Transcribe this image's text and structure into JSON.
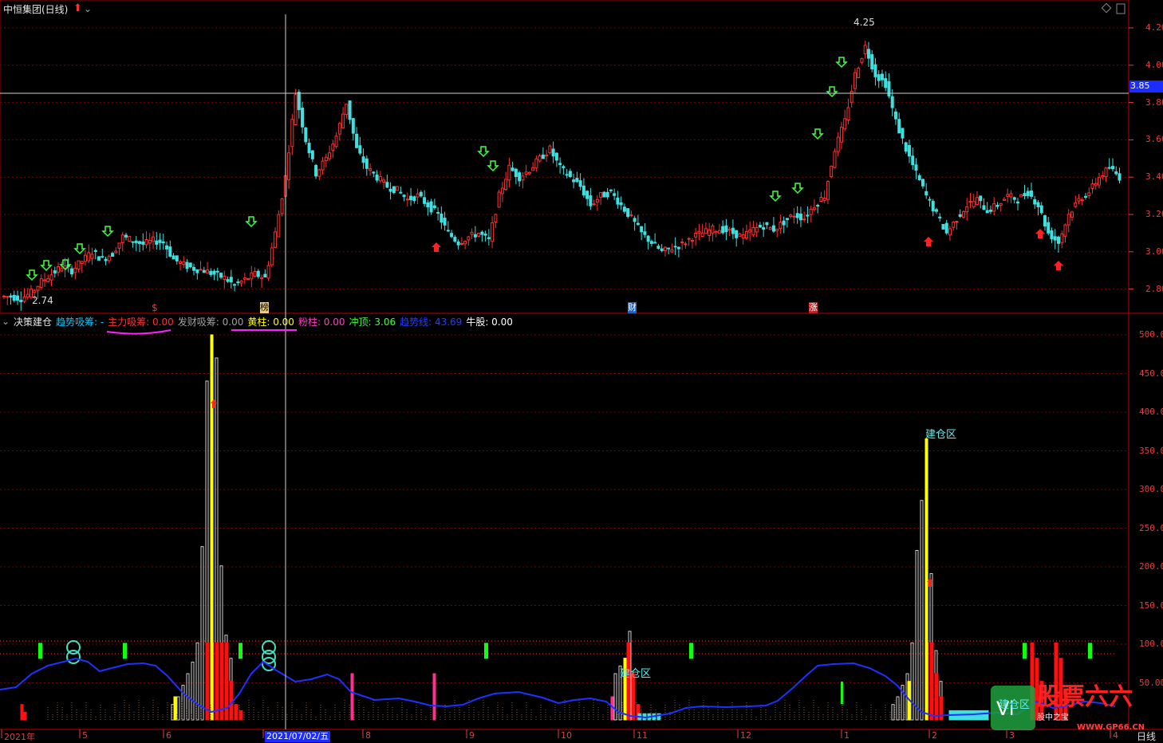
{
  "header": {
    "title": "中恒集团(日线)",
    "sub_title": "决策建仓",
    "indicators": [
      {
        "name": "趋势吸筹:",
        "value": "-",
        "color": "#00c8ff"
      },
      {
        "name": "主力吸筹:",
        "value": "0.00",
        "color": "#ff3030"
      },
      {
        "name": "发财吸筹:",
        "value": "0.00",
        "color": "#a0a0a0"
      },
      {
        "name": "黄柱:",
        "value": "0.00",
        "color": "#ffff00"
      },
      {
        "name": "粉柱:",
        "value": "0.00",
        "color": "#ff40c0"
      },
      {
        "name": "冲顶:",
        "value": "3.06",
        "color": "#40ff40"
      },
      {
        "name": "趋势线:",
        "value": "43.69",
        "color": "#2040ff"
      },
      {
        "name": "牛股:",
        "value": "0.00",
        "color": "#ffffff"
      }
    ]
  },
  "price_axis": [
    "4.20",
    "4.00",
    "3.80",
    "3.60",
    "3.40",
    "3.20",
    "3.00",
    "2.80"
  ],
  "current_price": "3.85",
  "high_label": "4.25",
  "low_label": "2.74",
  "indicator_axis": [
    "500.00",
    "450.00",
    "400.00",
    "350.00",
    "300.00",
    "250.00",
    "200.00",
    "150.00",
    "100.00",
    "50.00"
  ],
  "x_axis": [
    "2021年",
    "5",
    "6",
    "7",
    "8",
    "9",
    "10",
    "11",
    "12",
    "1",
    "2",
    "3",
    "4"
  ],
  "cursor_date": "2021/07/02/五",
  "period_label": "日线",
  "event_marks": [
    "$",
    "榜",
    "财",
    "涨"
  ],
  "zone_labels": [
    "建仓区",
    "建仓区",
    "建仓区"
  ],
  "watermark": {
    "text": "股票六六",
    "url": "WWW.GP66.CN",
    "tag": "股中之宝"
  },
  "colors": {
    "up": "#ff3030",
    "down": "#40e0e0",
    "grid": "#8b0000",
    "axis": "#e04040",
    "trend": "#2030ff"
  },
  "chart_data": {
    "type": "candlestick",
    "y_range": [
      2.7,
      4.3
    ],
    "close_series": [
      2.76,
      2.75,
      2.78,
      2.84,
      2.88,
      2.92,
      2.9,
      2.95,
      3.0,
      2.96,
      2.99,
      3.08,
      3.06,
      3.04,
      3.06,
      3.05,
      2.96,
      2.93,
      2.91,
      2.9,
      2.88,
      2.86,
      2.82,
      2.85,
      2.88,
      2.86,
      3.1,
      3.4,
      3.85,
      3.6,
      3.42,
      3.5,
      3.62,
      3.8,
      3.55,
      3.45,
      3.4,
      3.35,
      3.33,
      3.28,
      3.3,
      3.25,
      3.2,
      3.1,
      3.05,
      3.08,
      3.1,
      3.06,
      3.3,
      3.45,
      3.4,
      3.44,
      3.5,
      3.55,
      3.45,
      3.4,
      3.35,
      3.25,
      3.3,
      3.32,
      3.25,
      3.18,
      3.1,
      3.05,
      3.0,
      3.02,
      3.04,
      3.08,
      3.1,
      3.12,
      3.12,
      3.1,
      3.08,
      3.12,
      3.14,
      3.12,
      3.16,
      3.2,
      3.18,
      3.25,
      3.3,
      3.55,
      3.7,
      3.95,
      4.1,
      3.95,
      3.9,
      3.7,
      3.55,
      3.42,
      3.3,
      3.2,
      3.1,
      3.18,
      3.25,
      3.28,
      3.22,
      3.25,
      3.3,
      3.28,
      3.32,
      3.25,
      3.1,
      3.05,
      3.2,
      3.28,
      3.32,
      3.4,
      3.45,
      3.4
    ]
  }
}
